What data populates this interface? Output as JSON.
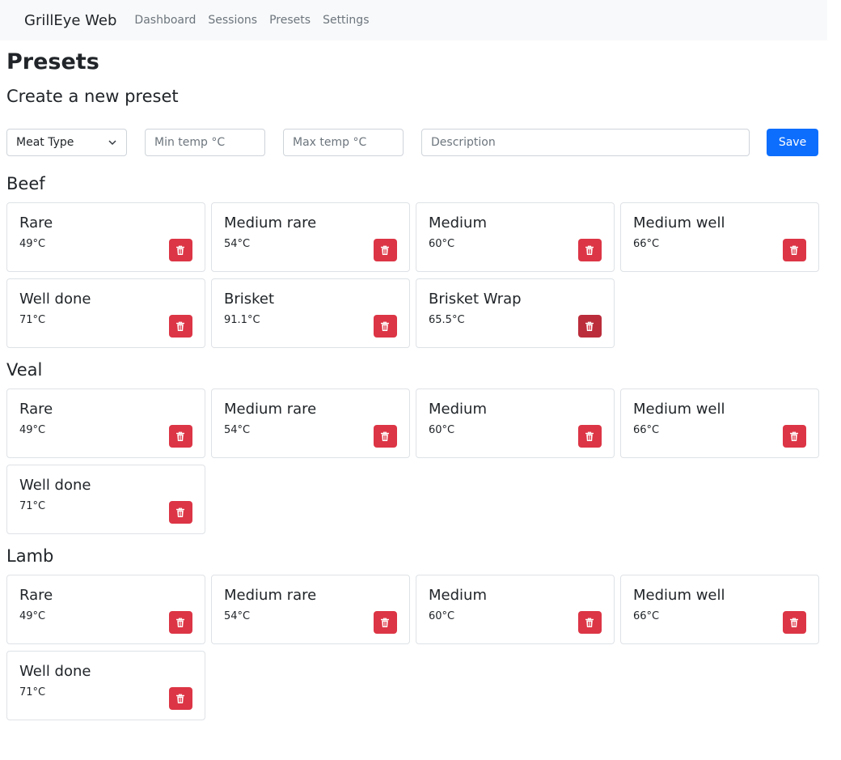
{
  "nav": {
    "brand": "GrillEye Web",
    "links": [
      "Dashboard",
      "Sessions",
      "Presets",
      "Settings"
    ]
  },
  "page_title": "Presets",
  "form": {
    "title": "Create a new preset",
    "meat_type": "Meat Type",
    "min_placeholder": "Min temp °C",
    "max_placeholder": "Max temp °C",
    "description_placeholder": "Description",
    "save_label": "Save"
  },
  "colors": {
    "primary": "#0d6efd",
    "danger": "#dc3545",
    "danger_hover": "#bb2d3b"
  },
  "groups": [
    {
      "name": "Beef",
      "presets": [
        {
          "name": "Rare",
          "temp": "49°C"
        },
        {
          "name": "Medium rare",
          "temp": "54°C"
        },
        {
          "name": "Medium",
          "temp": "60°C"
        },
        {
          "name": "Medium well",
          "temp": "66°C"
        },
        {
          "name": "Well done",
          "temp": "71°C"
        },
        {
          "name": "Brisket",
          "temp": "91.1°C"
        },
        {
          "name": "Brisket Wrap",
          "temp": "65.5°C"
        }
      ]
    },
    {
      "name": "Veal",
      "presets": [
        {
          "name": "Rare",
          "temp": "49°C"
        },
        {
          "name": "Medium rare",
          "temp": "54°C"
        },
        {
          "name": "Medium",
          "temp": "60°C"
        },
        {
          "name": "Medium well",
          "temp": "66°C"
        },
        {
          "name": "Well done",
          "temp": "71°C"
        }
      ]
    },
    {
      "name": "Lamb",
      "presets": [
        {
          "name": "Rare",
          "temp": "49°C"
        },
        {
          "name": "Medium rare",
          "temp": "54°C"
        },
        {
          "name": "Medium",
          "temp": "60°C"
        },
        {
          "name": "Medium well",
          "temp": "66°C"
        },
        {
          "name": "Well done",
          "temp": "71°C"
        }
      ]
    }
  ]
}
